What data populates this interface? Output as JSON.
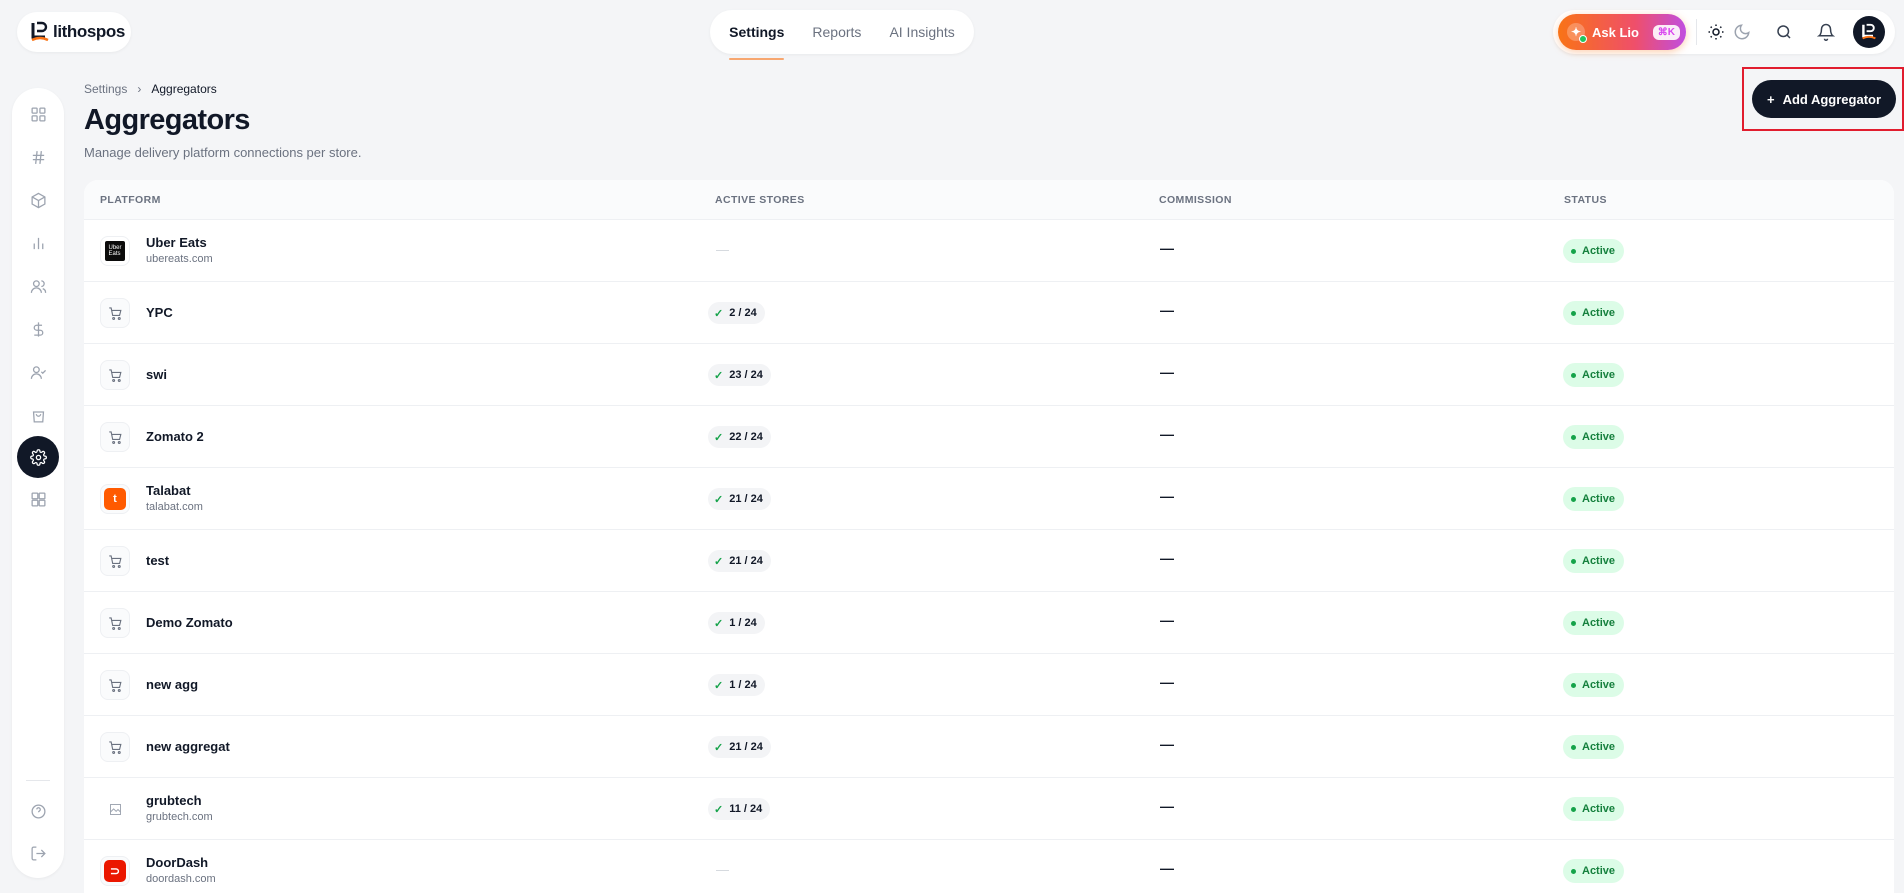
{
  "brand": {
    "name": "lithospos"
  },
  "topnav": {
    "tabs": [
      "Settings",
      "Reports",
      "AI Insights"
    ],
    "active": "Settings"
  },
  "assistant": {
    "label": "Ask Lio",
    "shortcut": "⌘K"
  },
  "breadcrumb": {
    "parent": "Settings",
    "current": "Aggregators"
  },
  "page": {
    "title": "Aggregators",
    "subtitle": "Manage delivery platform connections per store.",
    "add_button": "Add Aggregator"
  },
  "sidebar": {
    "items": [
      "grid-icon",
      "hash-icon",
      "box-icon",
      "bar-chart-icon",
      "users-icon",
      "dollar-icon",
      "user-check-icon",
      "shopping-bag-icon",
      "settings-icon",
      "apps-icon"
    ],
    "active": "settings-icon",
    "bottom": [
      "help-icon",
      "logout-icon"
    ]
  },
  "table": {
    "headers": {
      "platform": "PLATFORM",
      "active_stores": "ACTIVE STORES",
      "commission": "COMMISSION",
      "status": "STATUS"
    },
    "rows": [
      {
        "name": "Uber Eats",
        "domain": "ubereats.com",
        "icon": "uber",
        "stores": "—",
        "commission": "—",
        "status": "Active"
      },
      {
        "name": "YPC",
        "domain": "",
        "icon": "cart",
        "stores": "2 / 24",
        "commission": "—",
        "status": "Active"
      },
      {
        "name": "swi",
        "domain": "",
        "icon": "cart",
        "stores": "23 / 24",
        "commission": "—",
        "status": "Active"
      },
      {
        "name": "Zomato 2",
        "domain": "",
        "icon": "cart",
        "stores": "22 / 24",
        "commission": "—",
        "status": "Active"
      },
      {
        "name": "Talabat",
        "domain": "talabat.com",
        "icon": "talabat",
        "stores": "21 / 24",
        "commission": "—",
        "status": "Active"
      },
      {
        "name": "test",
        "domain": "",
        "icon": "cart",
        "stores": "21 / 24",
        "commission": "—",
        "status": "Active"
      },
      {
        "name": "Demo Zomato",
        "domain": "",
        "icon": "cart",
        "stores": "1 / 24",
        "commission": "—",
        "status": "Active"
      },
      {
        "name": "new agg",
        "domain": "",
        "icon": "cart",
        "stores": "1 / 24",
        "commission": "—",
        "status": "Active"
      },
      {
        "name": "new aggregat",
        "domain": "",
        "icon": "cart",
        "stores": "21 / 24",
        "commission": "—",
        "status": "Active"
      },
      {
        "name": "grubtech",
        "domain": "grubtech.com",
        "icon": "broken",
        "stores": "11 / 24",
        "commission": "—",
        "status": "Active"
      },
      {
        "name": "DoorDash",
        "domain": "doordash.com",
        "icon": "doordash",
        "stores": "—",
        "commission": "—",
        "status": "Active"
      }
    ]
  },
  "colors": {
    "accent": "#f97316",
    "dark": "#111827",
    "success_bg": "#dcfce7",
    "success_text": "#15803d",
    "highlight": "#e11d2e"
  }
}
